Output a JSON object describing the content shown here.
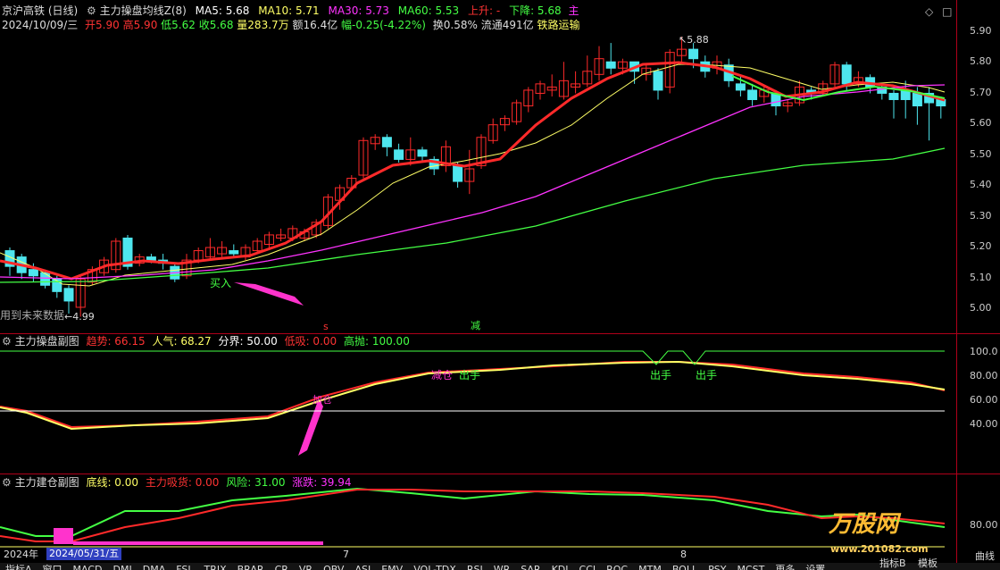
{
  "colors": {
    "up": "#ff2a2a",
    "down": "#4ee6ee",
    "ma5": "#ffffff",
    "ma10": "#ffff66",
    "ma30": "#ff33ff",
    "ma60": "#44ff44",
    "grid": "#b0001a",
    "accent": "#ff33cc"
  },
  "header": {
    "stock": "京沪高铁 (日线)",
    "indicator": "主力操盘均线Z(8)",
    "ma5": "MA5: 5.68",
    "ma10": "MA10: 5.71",
    "ma30": "MA30: 5.73",
    "ma60": "MA60: 5.53",
    "up_signal": "上升: -",
    "down_signal": "下降: 5.68",
    "extra": "主"
  },
  "quote": {
    "date": "2024/10/09/三",
    "open": "开5.90",
    "high": "高5.90",
    "low": "低5.62",
    "close": "收5.68",
    "volume": "量283.7万",
    "amount": "额16.4亿",
    "change": "幅-0.25(-4.22%)",
    "turnover": "换0.58%",
    "float": "流通491亿",
    "industry": "铁路运输"
  },
  "main_price_axis": [
    "5.90",
    "5.80",
    "5.70",
    "5.60",
    "5.50",
    "5.40",
    "5.30",
    "5.20",
    "5.10",
    "5.00"
  ],
  "annotations": {
    "high_mark": "5.88",
    "low_mark": "4.99",
    "buy": "买入",
    "future_note": "用到未来数据",
    "s_marker": "s",
    "reduce_marker": "减"
  },
  "sub1": {
    "title": "主力操盘副图",
    "trend": "趋势: 66.15",
    "popularity": "人气: 68.27",
    "boundary": "分界: 50.00",
    "low_buy": "低吸: 0.00",
    "high_sell": "高抛: 100.00",
    "axis": [
      "100.0",
      "80.00",
      "60.00",
      "40.00"
    ],
    "labels": {
      "reduce": "减仓",
      "exit1": "出手",
      "exit2": "出手",
      "exit3": "出手",
      "buy": "加仓"
    }
  },
  "sub2": {
    "title": "主力建仓副图",
    "bottom": "底线: 0.00",
    "absorb": "主力吸货: 0.00",
    "risk": "风险: 31.00",
    "change": "涨跌: 39.94",
    "axis": [
      "80.00"
    ]
  },
  "timeline": {
    "year": "2024年",
    "date": "2024/05/31/五",
    "m7": "7",
    "m8": "8"
  },
  "tabs": [
    "指标A",
    "窗口",
    "MACD",
    "DMI",
    "DMA",
    "FSL",
    "TRIX",
    "BRAR",
    "CR",
    "VR",
    "OBV",
    "ASI",
    "EMV",
    "VOL-TDX",
    "RSI",
    "WR",
    "SAR",
    "KDJ",
    "CCI",
    "ROC",
    "MTM",
    "BOLL",
    "PSY",
    "MCST",
    "更多",
    "设置"
  ],
  "tabs_right": [
    "指标B",
    "模板"
  ],
  "watermark": {
    "brand": "万股网",
    "url": "www.201082.com",
    "curve_label": "曲线"
  }
}
